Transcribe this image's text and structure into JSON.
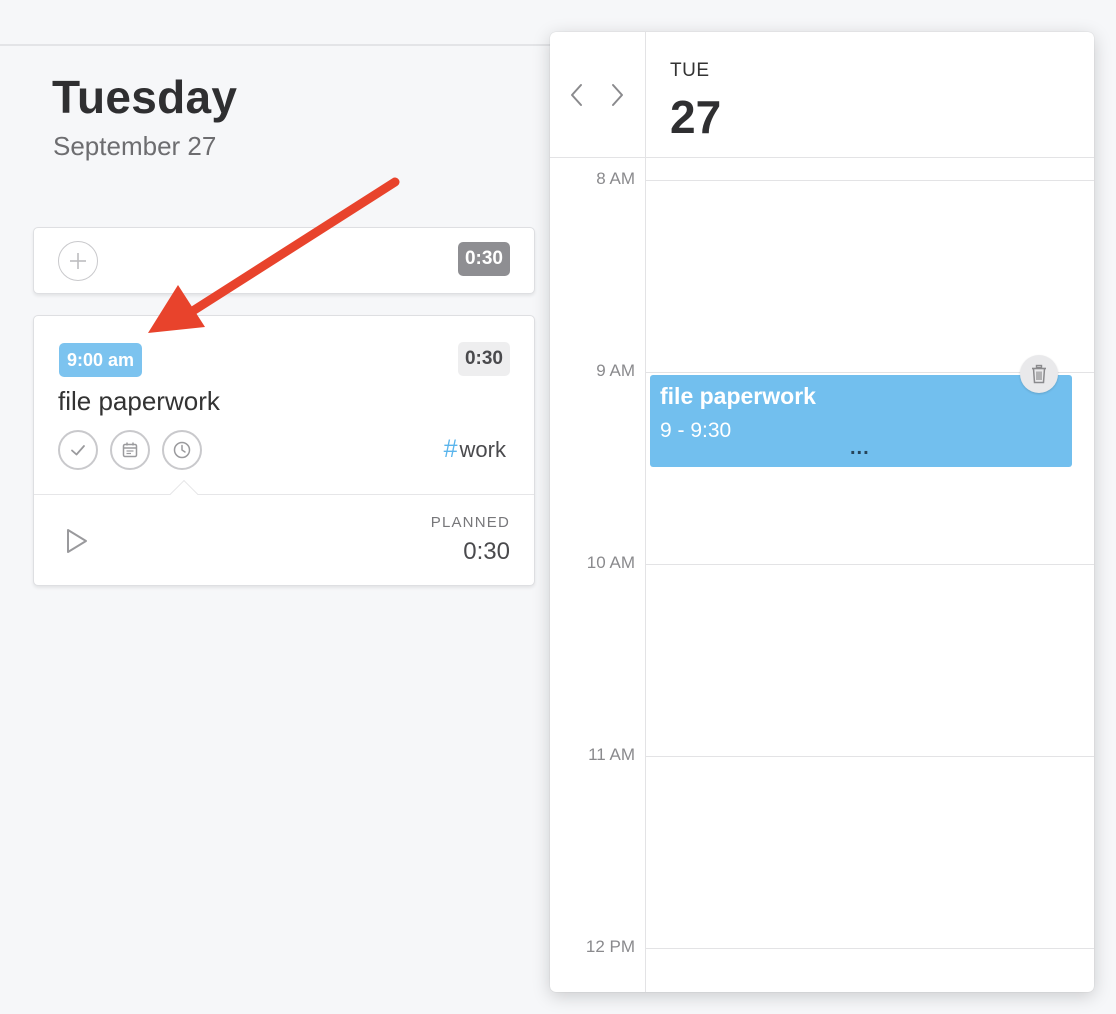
{
  "colors": {
    "accent_blue": "#72bfee",
    "arrow_red": "#e8432c",
    "background": "#f6f7f9"
  },
  "day": {
    "title": "Tuesday",
    "subtitle": "September 27"
  },
  "add_card": {
    "icon": "plus-icon",
    "duration": "0:30"
  },
  "task": {
    "time": "9:00 am",
    "duration": "0:30",
    "name": "file paperwork",
    "actions": [
      "check-icon",
      "calendar-icon",
      "clock-icon"
    ],
    "tag": "work",
    "planned_label": "PLANNED",
    "planned_value": "0:30"
  },
  "calendar": {
    "day_of_week": "TUE",
    "date": "27",
    "hours": [
      "8 AM",
      "9 AM",
      "10 AM",
      "11 AM",
      "12 PM"
    ],
    "event": {
      "title": "file paperwork",
      "time": "9 - 9:30",
      "more": "..."
    }
  }
}
